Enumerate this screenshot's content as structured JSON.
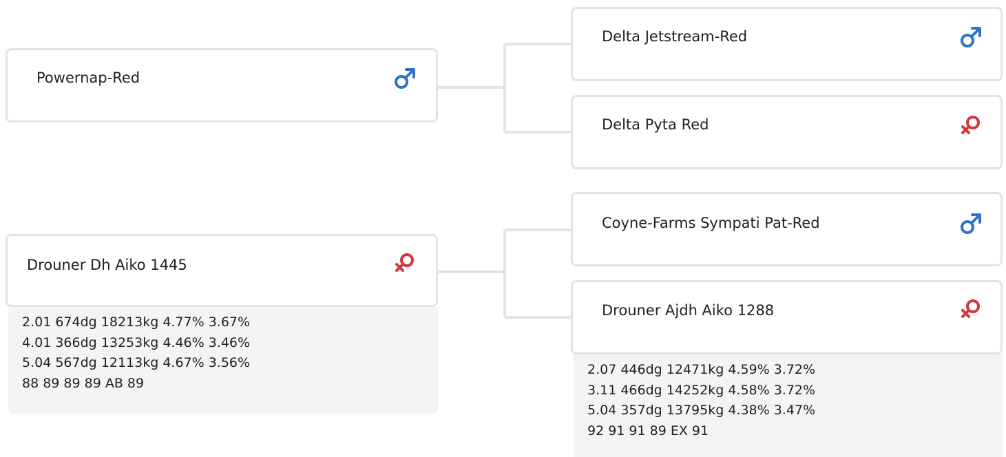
{
  "sire": {
    "name": "Powernap-Red",
    "sex_icon": "male-icon",
    "sire": {
      "name": "Delta Jetstream-Red",
      "sex_icon": "male-icon"
    },
    "dam": {
      "name": "Delta Pyta Red",
      "sex_icon": "female-icon"
    }
  },
  "dam": {
    "name": "Drouner Dh Aiko 1445",
    "sex_icon": "female-icon",
    "stats": [
      "2.01 674dg 18213kg 4.77% 3.67%",
      "4.01 366dg 13253kg 4.46% 3.46%",
      "5.04 567dg 12113kg 4.67% 3.56%",
      "88 89 89 89 AB 89"
    ],
    "sire": {
      "name": "Coyne-Farms Sympati Pat-Red",
      "sex_icon": "male-icon"
    },
    "dam": {
      "name": "Drouner Ajdh Aiko 1288",
      "sex_icon": "female-icon",
      "stats": [
        "2.07 446dg 12471kg 4.59% 3.72%",
        "3.11 466dg 14252kg 4.58% 3.72%",
        "5.04 357dg 13795kg 4.38% 3.47%",
        "92 91 91 89 EX 91"
      ]
    }
  },
  "colors": {
    "male": "#2f73c4",
    "female": "#d6353f",
    "card_border": "#e3e3e3",
    "connector": "#e3e3e3",
    "stats_bg": "#f4f4f4"
  }
}
